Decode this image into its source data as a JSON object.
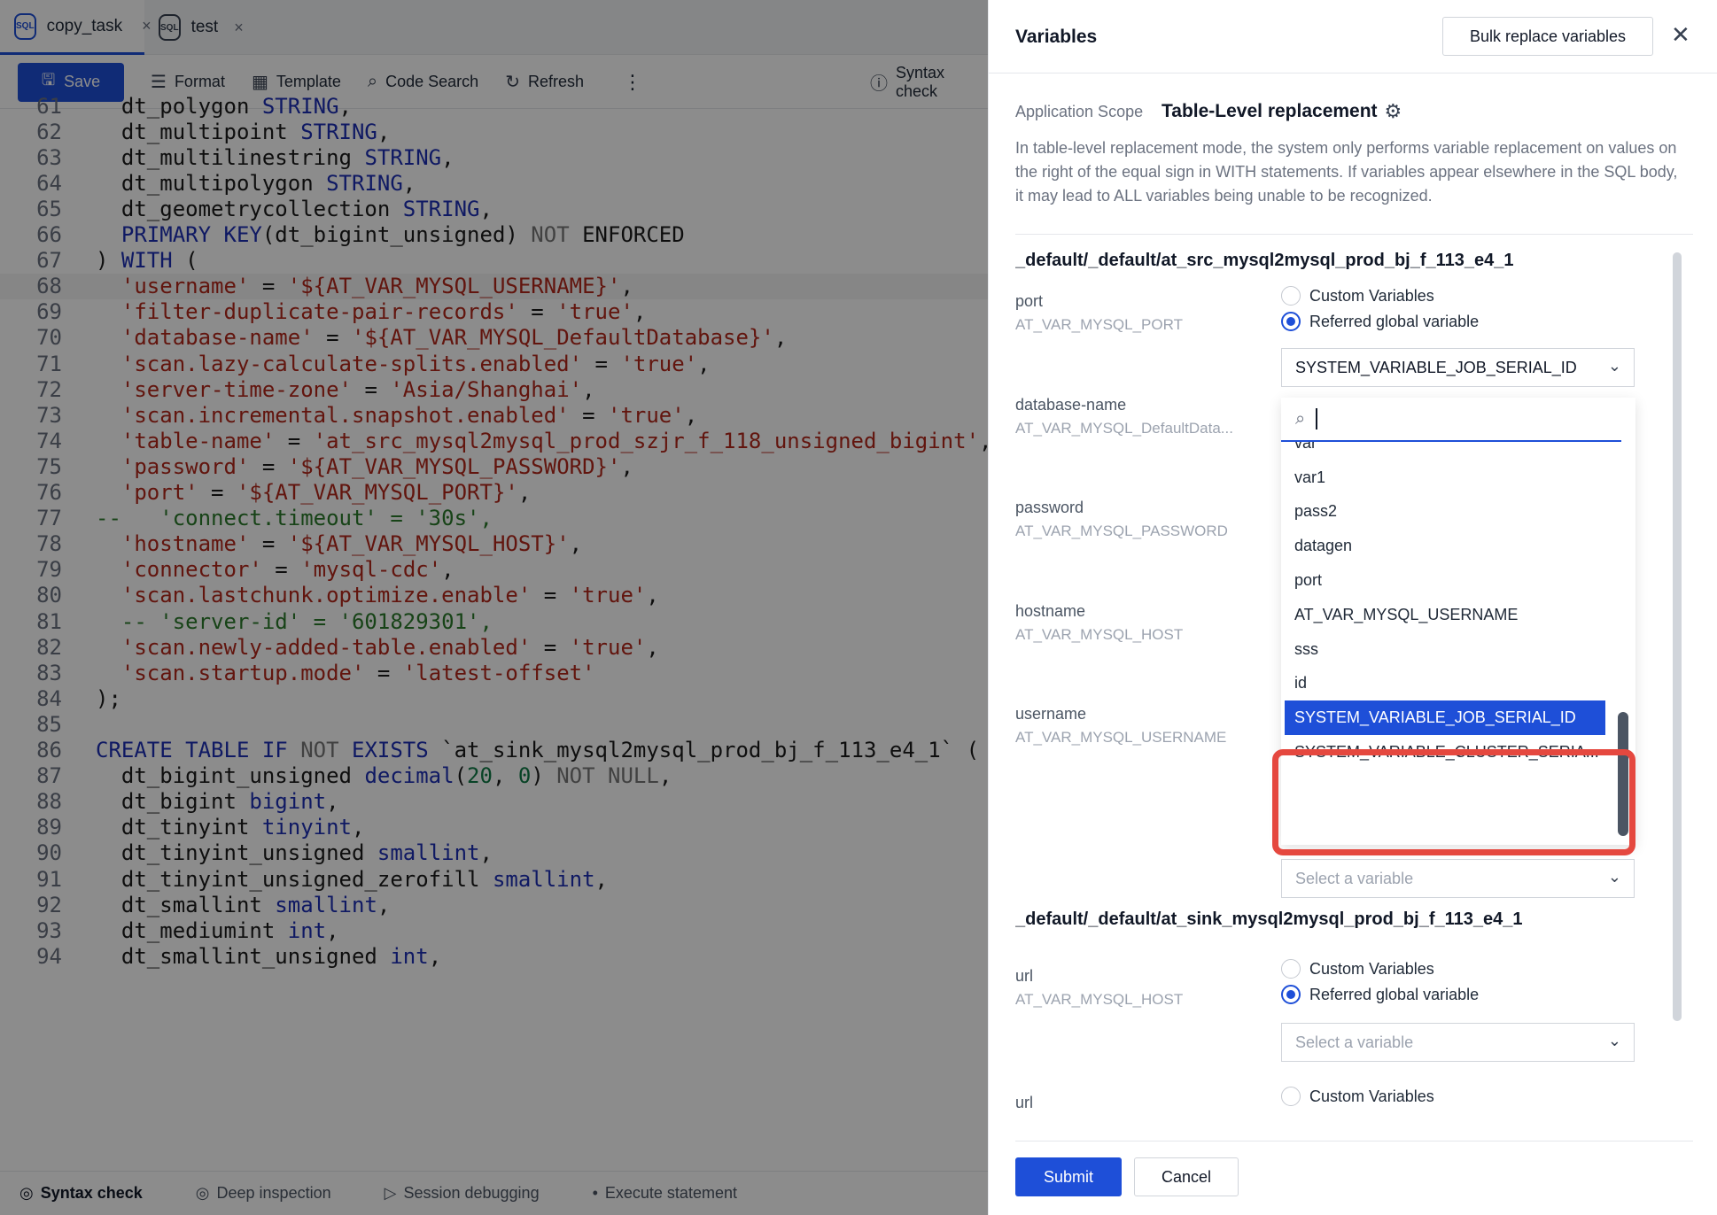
{
  "tabs": [
    {
      "label": "copy_task",
      "badge": "SQL"
    },
    {
      "label": "test",
      "badge": "SQL"
    }
  ],
  "toolbar": {
    "save": "Save",
    "format": "Format",
    "template": "Template",
    "code_search": "Code Search",
    "refresh": "Refresh",
    "more": "⋮",
    "syntax_check": "Syntax check"
  },
  "code_lines": [
    {
      "n": "61",
      "t": [
        [
          "  dt_polygon ",
          ""
        ],
        [
          "STRING",
          "kw"
        ],
        [
          ",",
          ""
        ]
      ]
    },
    {
      "n": "62",
      "t": [
        [
          "  dt_multipoint ",
          ""
        ],
        [
          "STRING",
          "kw"
        ],
        [
          ",",
          ""
        ]
      ]
    },
    {
      "n": "63",
      "t": [
        [
          "  dt_multilinestring ",
          ""
        ],
        [
          "STRING",
          "kw"
        ],
        [
          ",",
          ""
        ]
      ]
    },
    {
      "n": "64",
      "t": [
        [
          "  dt_multipolygon ",
          ""
        ],
        [
          "STRING",
          "kw"
        ],
        [
          ",",
          ""
        ]
      ]
    },
    {
      "n": "65",
      "t": [
        [
          "  dt_geometrycollection ",
          ""
        ],
        [
          "STRING",
          "kw"
        ],
        [
          ",",
          ""
        ]
      ]
    },
    {
      "n": "66",
      "t": [
        [
          "  ",
          ""
        ],
        [
          "PRIMARY KEY",
          "kw"
        ],
        [
          "(dt_bigint_unsigned) ",
          ""
        ],
        [
          "NOT",
          "gr"
        ],
        [
          " ENFORCED",
          ""
        ]
      ]
    },
    {
      "n": "67",
      "t": [
        [
          ") ",
          ""
        ],
        [
          "WITH",
          "kw"
        ],
        [
          " (",
          ""
        ]
      ]
    },
    {
      "n": "68",
      "t": [
        [
          "  ",
          ""
        ],
        [
          "'username'",
          "str"
        ],
        [
          " = ",
          ""
        ],
        [
          "'${AT_VAR_MYSQL_USERNAME}'",
          "str"
        ],
        [
          ",",
          ""
        ]
      ],
      "hl": true
    },
    {
      "n": "69",
      "t": [
        [
          "  ",
          ""
        ],
        [
          "'filter-duplicate-pair-records'",
          "str"
        ],
        [
          " = ",
          ""
        ],
        [
          "'true'",
          "str"
        ],
        [
          ",",
          ""
        ]
      ]
    },
    {
      "n": "70",
      "t": [
        [
          "  ",
          ""
        ],
        [
          "'database-name'",
          "str"
        ],
        [
          " = ",
          ""
        ],
        [
          "'${AT_VAR_MYSQL_DefaultDatabase}'",
          "str"
        ],
        [
          ",",
          ""
        ]
      ]
    },
    {
      "n": "71",
      "t": [
        [
          "  ",
          ""
        ],
        [
          "'scan.lazy-calculate-splits.enabled'",
          "str"
        ],
        [
          " = ",
          ""
        ],
        [
          "'true'",
          "str"
        ],
        [
          ",",
          ""
        ]
      ]
    },
    {
      "n": "72",
      "t": [
        [
          "  ",
          ""
        ],
        [
          "'server-time-zone'",
          "str"
        ],
        [
          " = ",
          ""
        ],
        [
          "'Asia/Shanghai'",
          "str"
        ],
        [
          ",",
          ""
        ]
      ]
    },
    {
      "n": "73",
      "t": [
        [
          "  ",
          ""
        ],
        [
          "'scan.incremental.snapshot.enabled'",
          "str"
        ],
        [
          " = ",
          ""
        ],
        [
          "'true'",
          "str"
        ],
        [
          ",",
          ""
        ]
      ]
    },
    {
      "n": "74",
      "t": [
        [
          "  ",
          ""
        ],
        [
          "'table-name'",
          "str"
        ],
        [
          " = ",
          ""
        ],
        [
          "'at_src_mysql2mysql_prod_szjr_f_118_unsigned_bigint'",
          "str"
        ],
        [
          ",",
          ""
        ]
      ]
    },
    {
      "n": "75",
      "t": [
        [
          "  ",
          ""
        ],
        [
          "'password'",
          "str"
        ],
        [
          " = ",
          ""
        ],
        [
          "'${AT_VAR_MYSQL_PASSWORD}'",
          "str"
        ],
        [
          ",",
          ""
        ]
      ]
    },
    {
      "n": "76",
      "t": [
        [
          "  ",
          ""
        ],
        [
          "'port'",
          "str"
        ],
        [
          " = ",
          ""
        ],
        [
          "'${AT_VAR_MYSQL_PORT}'",
          "str"
        ],
        [
          ",",
          ""
        ]
      ]
    },
    {
      "n": "77",
      "t": [
        [
          "--   'connect.timeout' = '30s',",
          "cm"
        ]
      ],
      "shift": true
    },
    {
      "n": "78",
      "t": [
        [
          "  ",
          ""
        ],
        [
          "'hostname'",
          "str"
        ],
        [
          " = ",
          ""
        ],
        [
          "'${AT_VAR_MYSQL_HOST}'",
          "str"
        ],
        [
          ",",
          ""
        ]
      ]
    },
    {
      "n": "79",
      "t": [
        [
          "  ",
          ""
        ],
        [
          "'connector'",
          "str"
        ],
        [
          " = ",
          ""
        ],
        [
          "'mysql-cdc'",
          "str"
        ],
        [
          ",",
          ""
        ]
      ]
    },
    {
      "n": "80",
      "t": [
        [
          "  ",
          ""
        ],
        [
          "'scan.lastchunk.optimize.enable'",
          "str"
        ],
        [
          " = ",
          ""
        ],
        [
          "'true'",
          "str"
        ],
        [
          ",",
          ""
        ]
      ]
    },
    {
      "n": "81",
      "t": [
        [
          "  -- 'server-id' = '601829301',",
          "cm"
        ]
      ]
    },
    {
      "n": "82",
      "t": [
        [
          "  ",
          ""
        ],
        [
          "'scan.newly-added-table.enabled'",
          "str"
        ],
        [
          " = ",
          ""
        ],
        [
          "'true'",
          "str"
        ],
        [
          ",",
          ""
        ]
      ]
    },
    {
      "n": "83",
      "t": [
        [
          "  ",
          ""
        ],
        [
          "'scan.startup.mode'",
          "str"
        ],
        [
          " = ",
          ""
        ],
        [
          "'latest-offset'",
          "str"
        ]
      ]
    },
    {
      "n": "84",
      "t": [
        [
          ");",
          ""
        ]
      ]
    },
    {
      "n": "85",
      "t": [
        [
          "",
          ""
        ]
      ]
    },
    {
      "n": "86",
      "t": [
        [
          "CREATE TABLE IF ",
          "kw"
        ],
        [
          "NOT",
          "gr"
        ],
        [
          " EXISTS",
          "kw"
        ],
        [
          " `at_sink_mysql2mysql_prod_bj_f_113_e4_1` (",
          ""
        ]
      ]
    },
    {
      "n": "87",
      "t": [
        [
          "  dt_bigint_unsigned ",
          ""
        ],
        [
          "decimal",
          "kw"
        ],
        [
          "(",
          ""
        ],
        [
          "20",
          "num"
        ],
        [
          ", ",
          ""
        ],
        [
          "0",
          "num"
        ],
        [
          ") ",
          ""
        ],
        [
          "NOT NULL",
          "gr"
        ],
        [
          ",",
          ""
        ]
      ]
    },
    {
      "n": "88",
      "t": [
        [
          "  dt_bigint ",
          ""
        ],
        [
          "bigint",
          "kw"
        ],
        [
          ",",
          ""
        ]
      ]
    },
    {
      "n": "89",
      "t": [
        [
          "  dt_tinyint ",
          ""
        ],
        [
          "tinyint",
          "kw"
        ],
        [
          ",",
          ""
        ]
      ]
    },
    {
      "n": "90",
      "t": [
        [
          "  dt_tinyint_unsigned ",
          ""
        ],
        [
          "smallint",
          "kw"
        ],
        [
          ",",
          ""
        ]
      ]
    },
    {
      "n": "91",
      "t": [
        [
          "  dt_tinyint_unsigned_zerofill ",
          ""
        ],
        [
          "smallint",
          "kw"
        ],
        [
          ",",
          ""
        ]
      ]
    },
    {
      "n": "92",
      "t": [
        [
          "  dt_smallint ",
          ""
        ],
        [
          "smallint",
          "kw"
        ],
        [
          ",",
          ""
        ]
      ]
    },
    {
      "n": "93",
      "t": [
        [
          "  dt_mediumint ",
          ""
        ],
        [
          "int",
          "kw"
        ],
        [
          ",",
          ""
        ]
      ]
    },
    {
      "n": "94",
      "t": [
        [
          "  dt_smallint_unsigned ",
          ""
        ],
        [
          "int",
          "kw"
        ],
        [
          ",",
          ""
        ]
      ]
    }
  ],
  "statusbar": {
    "syntax_check": "Syntax check",
    "deep_inspection": "Deep inspection",
    "session_debugging": "Session debugging",
    "execute_statement": "Execute statement"
  },
  "drawer": {
    "title": "Variables",
    "bulk_replace": "Bulk replace variables",
    "scope_label": "Application Scope",
    "scope_value": "Table-Level replacement",
    "scope_desc": "In table-level replacement mode, the system only performs variable replacement on values on the right of the equal sign in WITH statements. If variables appear elsewhere in the SQL body, it may lead to ALL variables being unable to be recognized.",
    "section1_title": "_default/_default/at_src_mysql2mysql_prod_bj_f_113_e4_1",
    "section2_title": "_default/_default/at_sink_mysql2mysql_prod_bj_f_113_e4_1",
    "custom_label": "Custom Variables",
    "global_label": "Referred global variable",
    "fields": [
      {
        "name": "port",
        "var": "AT_VAR_MYSQL_PORT",
        "selected": "SYSTEM_VARIABLE_JOB_SERIAL_ID"
      },
      {
        "name": "database-name",
        "var": "AT_VAR_MYSQL_DefaultData..."
      },
      {
        "name": "password",
        "var": "AT_VAR_MYSQL_PASSWORD"
      },
      {
        "name": "hostname",
        "var": "AT_VAR_MYSQL_HOST"
      },
      {
        "name": "username",
        "var": "AT_VAR_MYSQL_USERNAME",
        "placeholder": "Select a variable"
      }
    ],
    "sink_fields": [
      {
        "name": "url",
        "var": "AT_VAR_MYSQL_HOST",
        "placeholder": "Select a variable"
      },
      {
        "name": "url",
        "var": ""
      }
    ],
    "dropdown_items": [
      "var",
      "var1",
      "pass2",
      "datagen",
      "port",
      "AT_VAR_MYSQL_USERNAME",
      "sss",
      "id",
      "SYSTEM_VARIABLE_JOB_SERIAL_ID",
      "SYSTEM_VARIABLE_CLUSTER_SERIA..."
    ],
    "dropdown_selected_index": 8,
    "submit": "Submit",
    "cancel": "Cancel"
  },
  "colors": {
    "accent": "#1e4fd8",
    "highlight_box": "#e5483f"
  }
}
